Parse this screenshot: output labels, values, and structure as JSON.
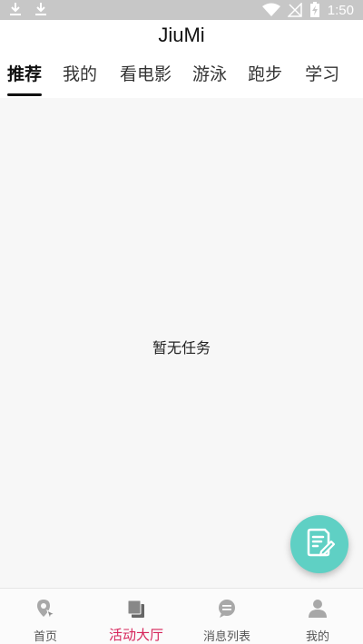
{
  "status_bar": {
    "time": "1:50",
    "left_icons": [
      "download-icon",
      "download-icon"
    ],
    "right_icons": [
      "wifi-icon",
      "no-signal-icon",
      "battery-charging-icon"
    ]
  },
  "header": {
    "title": "JiuMi",
    "tabs": [
      {
        "label": "推荐",
        "active": true
      },
      {
        "label": "我的",
        "active": false
      },
      {
        "label": "看电影",
        "active": false
      },
      {
        "label": "游泳",
        "active": false
      },
      {
        "label": "跑步",
        "active": false
      },
      {
        "label": "学习",
        "active": false
      }
    ]
  },
  "main": {
    "empty_text": "暂无任务"
  },
  "fab": {
    "icon": "edit-document-icon",
    "color": "#5fd0c4"
  },
  "bottom_nav": {
    "active_color": "#d6245a",
    "items": [
      {
        "label": "首页",
        "icon": "location-icon",
        "active": false
      },
      {
        "label": "活动大厅",
        "icon": "cards-icon",
        "active": true
      },
      {
        "label": "消息列表",
        "icon": "chat-bubble-icon",
        "active": false
      },
      {
        "label": "我的",
        "icon": "user-icon",
        "active": false
      }
    ]
  }
}
